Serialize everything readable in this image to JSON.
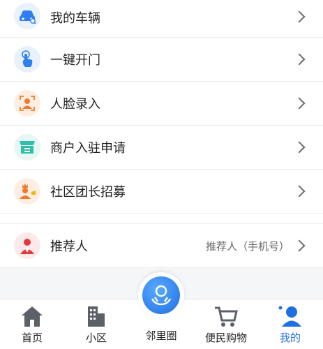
{
  "menu": {
    "items": [
      {
        "label": "我的车辆",
        "icon": "car-icon"
      },
      {
        "label": "一键开门",
        "icon": "tap-icon"
      },
      {
        "label": "人脸录入",
        "icon": "face-scan-icon"
      },
      {
        "label": "商户入驻申请",
        "icon": "shop-icon"
      },
      {
        "label": "社区团长招募",
        "icon": "leader-icon"
      },
      {
        "label": "推荐人",
        "icon": "referrer-icon",
        "hint": "推荐人（手机号）"
      }
    ]
  },
  "tabbar": {
    "tabs": [
      {
        "label": "首页",
        "icon": "home-icon"
      },
      {
        "label": "小区",
        "icon": "building-icon"
      },
      {
        "label": "邻里圈",
        "icon": "neighbor-icon"
      },
      {
        "label": "便民购物",
        "icon": "cart-icon"
      },
      {
        "label": "我的",
        "icon": "profile-icon",
        "active": true
      }
    ]
  },
  "colors": {
    "accent": "#1e6fe0",
    "orange": "#f07a2a"
  }
}
